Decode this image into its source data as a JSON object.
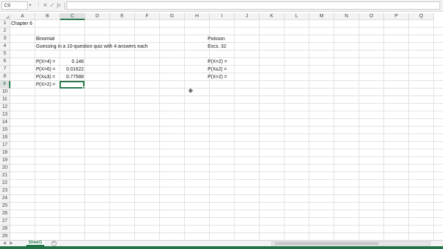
{
  "formula_bar": {
    "name_box": "C9",
    "fx_label": "fx",
    "cancel_icon": "close-icon",
    "enter_icon": "check-icon",
    "formula": ""
  },
  "columns": [
    "A",
    "B",
    "C",
    "D",
    "E",
    "F",
    "G",
    "H",
    "I",
    "J",
    "K",
    "L",
    "M",
    "N",
    "O",
    "P",
    "Q"
  ],
  "rows": [
    "1",
    "2",
    "3",
    "4",
    "5",
    "6",
    "7",
    "8",
    "9",
    "10",
    "11",
    "12",
    "13",
    "14",
    "15",
    "16",
    "17",
    "18",
    "19",
    "20",
    "21",
    "22",
    "23",
    "24",
    "25",
    "26",
    "27",
    "28",
    "29"
  ],
  "selected_cell": "C9",
  "cells": {
    "a1": "Chapter 6",
    "b3": "Binomial",
    "b4": "Guessing in a 10-question quiz with 4 answers each",
    "b6": "P(X=4) =",
    "c6": "0.146",
    "b7": "P(X=6) =",
    "c7": "0.01622",
    "b8": "P(X≤3) =",
    "c8": "0.77588",
    "b9": "P(X>2) =",
    "i3": "Poisson",
    "i4": "Excs. 32",
    "i6": "P(X=2) =",
    "i7": "P(X≤2) =",
    "i8": "P(X>2) ="
  },
  "sheet_tabs": [
    "Sheet1"
  ],
  "add_sheet_label": "+"
}
